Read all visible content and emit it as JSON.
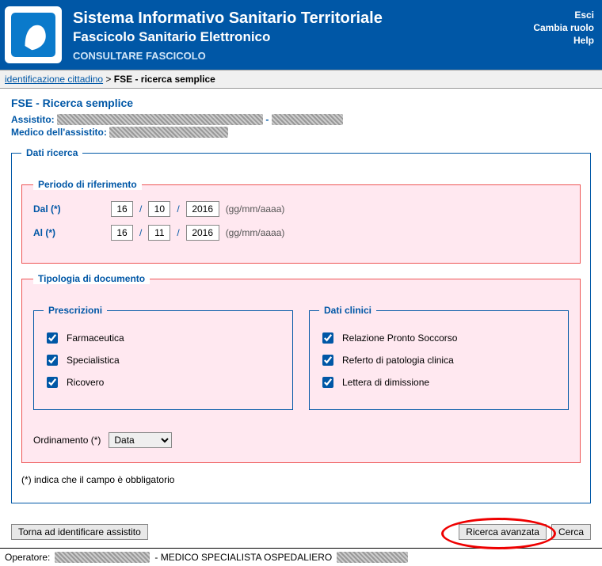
{
  "header": {
    "title1": "Sistema Informativo Sanitario Territoriale",
    "title2": "Fascicolo Sanitario Elettronico",
    "title3": "CONSULTARE FASCICOLO",
    "links": {
      "esci": "Esci",
      "cambia": "Cambia ruolo",
      "help": "Help"
    }
  },
  "breadcrumb": {
    "first": "identificazione cittadino",
    "sep": ">",
    "current": "FSE - ricerca semplice"
  },
  "section_title": "FSE - Ricerca semplice",
  "assistito_label": "Assistito:",
  "medico_label": "Medico dell'assistito:",
  "fieldsets": {
    "dati_ricerca": "Dati ricerca",
    "periodo": "Periodo di riferimento",
    "tipologia": "Tipologia di documento",
    "prescrizioni": "Prescrizioni",
    "dati_clinici": "Dati clinici"
  },
  "dates": {
    "dal_label": "Dal (*)",
    "al_label": "Al (*)",
    "hint": "(gg/mm/aaaa)",
    "sep": "/",
    "dal": {
      "d": "16",
      "m": "10",
      "y": "2016"
    },
    "al": {
      "d": "16",
      "m": "11",
      "y": "2016"
    }
  },
  "checks": {
    "farmaceutica": "Farmaceutica",
    "specialistica": "Specialistica",
    "ricovero": "Ricovero",
    "pronto_soccorso": "Relazione Pronto Soccorso",
    "referto": "Referto di patologia clinica",
    "lettera": "Lettera di dimissione"
  },
  "ordinamento": {
    "label": "Ordinamento (*)",
    "selected": "Data"
  },
  "mandatory_note": "(*) indica che il campo è obbligatorio",
  "buttons": {
    "back": "Torna ad identificare assistito",
    "advanced": "Ricerca avanzata",
    "search": "Cerca"
  },
  "footer": {
    "operatore_label": "Operatore:",
    "role": "- MEDICO SPECIALISTA OSPEDALIERO"
  }
}
